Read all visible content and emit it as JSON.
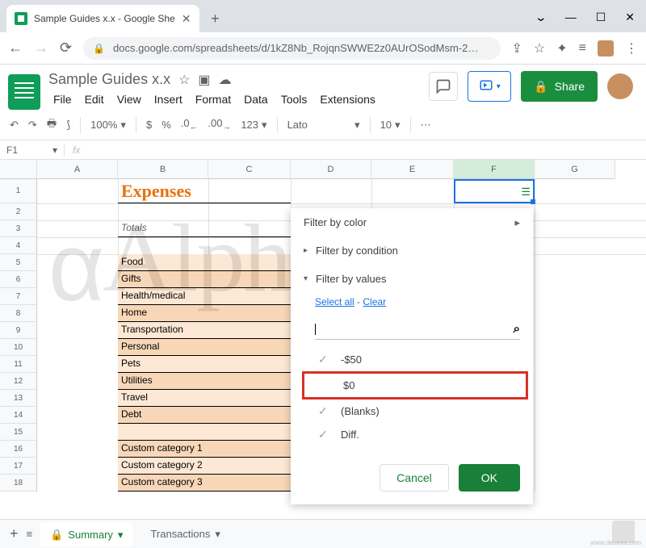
{
  "browser": {
    "tab_title": "Sample Guides x.x - Google She",
    "url": "docs.google.com/spreadsheets/d/1kZ8Nb_RojqnSWWE2z0AUrOSodMsm-2…",
    "window_min": "—",
    "window_max": "☐",
    "window_close": "✕",
    "chevron": "⌄"
  },
  "doc": {
    "title": "Sample Guides x.x",
    "menus": [
      "File",
      "Edit",
      "View",
      "Insert",
      "Format",
      "Data",
      "Tools",
      "Extensions"
    ],
    "share": "Share"
  },
  "toolbar": {
    "zoom": "100%",
    "currency": "$",
    "percent": "%",
    "dec_dec": ".0",
    "dec_inc": ".00",
    "num_fmt": "123",
    "font": "Lato",
    "font_size": "10",
    "more": "⋯"
  },
  "namebox": "F1",
  "cols": [
    "A",
    "B",
    "C",
    "D",
    "E",
    "F",
    "G"
  ],
  "rows": [
    "1",
    "2",
    "3",
    "4",
    "5",
    "6",
    "7",
    "8",
    "9",
    "10",
    "11",
    "12",
    "13",
    "14",
    "15",
    "16",
    "17",
    "18"
  ],
  "sheet": {
    "title": "Expenses",
    "totals": "Totals",
    "categories": [
      "Food",
      "Gifts",
      "Health/medical",
      "Home",
      "Transportation",
      "Personal",
      "Pets",
      "Utilities",
      "Travel",
      "Debt",
      "",
      "Custom category 1",
      "Custom category 2",
      "Custom category 3"
    ]
  },
  "filter": {
    "by_color": "Filter by color",
    "by_condition": "Filter by condition",
    "by_values": "Filter by values",
    "select_all": "Select all",
    "clear": "Clear",
    "values": [
      "-$50",
      "$0",
      "(Blanks)",
      "Diff."
    ],
    "cancel": "Cancel",
    "ok": "OK"
  },
  "tabs": {
    "summary": "Summary",
    "transactions": "Transactions"
  },
  "watermark": "Alphr",
  "attribution": "www.deuexa.com"
}
